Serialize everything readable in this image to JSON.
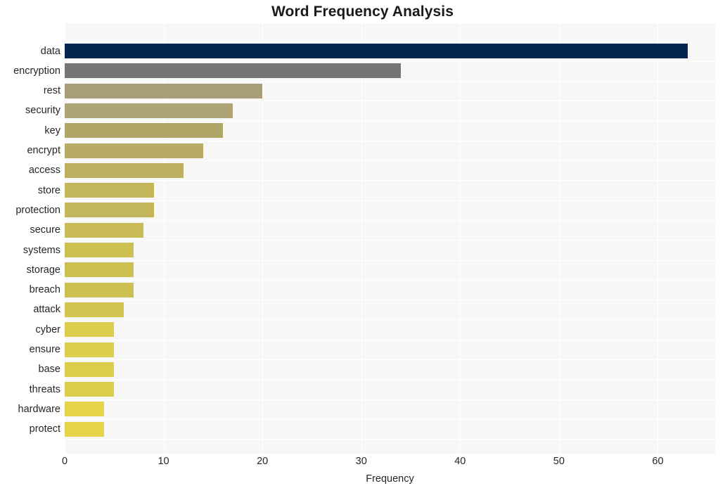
{
  "chart_data": {
    "type": "bar",
    "orientation": "horizontal",
    "title": "Word Frequency Analysis",
    "xlabel": "Frequency",
    "ylabel": "",
    "xlim": [
      0,
      65.8
    ],
    "xticks": [
      0,
      10,
      20,
      30,
      40,
      50,
      60
    ],
    "xtick_labels": [
      "0",
      "10",
      "20",
      "30",
      "40",
      "50",
      "60"
    ],
    "grid": true,
    "grid_axis": "x",
    "legend": null,
    "categories": [
      "data",
      "encryption",
      "rest",
      "security",
      "key",
      "encrypt",
      "access",
      "store",
      "protection",
      "secure",
      "systems",
      "storage",
      "breach",
      "attack",
      "cyber",
      "ensure",
      "base",
      "threats",
      "hardware",
      "protect"
    ],
    "values": [
      63,
      34,
      20,
      17,
      16,
      14,
      12,
      9,
      9,
      8,
      7,
      7,
      7,
      6,
      5,
      5,
      5,
      5,
      4,
      4
    ],
    "bar_colors": [
      "#04254f",
      "#757577",
      "#a89d76",
      "#ae a277",
      "#b0a668",
      "#b7ab64",
      "#bcaf5f",
      "#c3b65a",
      "#c3b65a",
      "#c9bb56",
      "#cdc053",
      "#cdc053",
      "#cdc053",
      "#d3c54f",
      "#dccd4c",
      "#dccd4c",
      "#dccd4c",
      "#dccd4c",
      "#e6d549",
      "#e6d549"
    ],
    "plot_background": "#f7f7f7",
    "figure_background": "#ffffff",
    "text_color": "#262626",
    "title_color": "#1a1a1a"
  }
}
